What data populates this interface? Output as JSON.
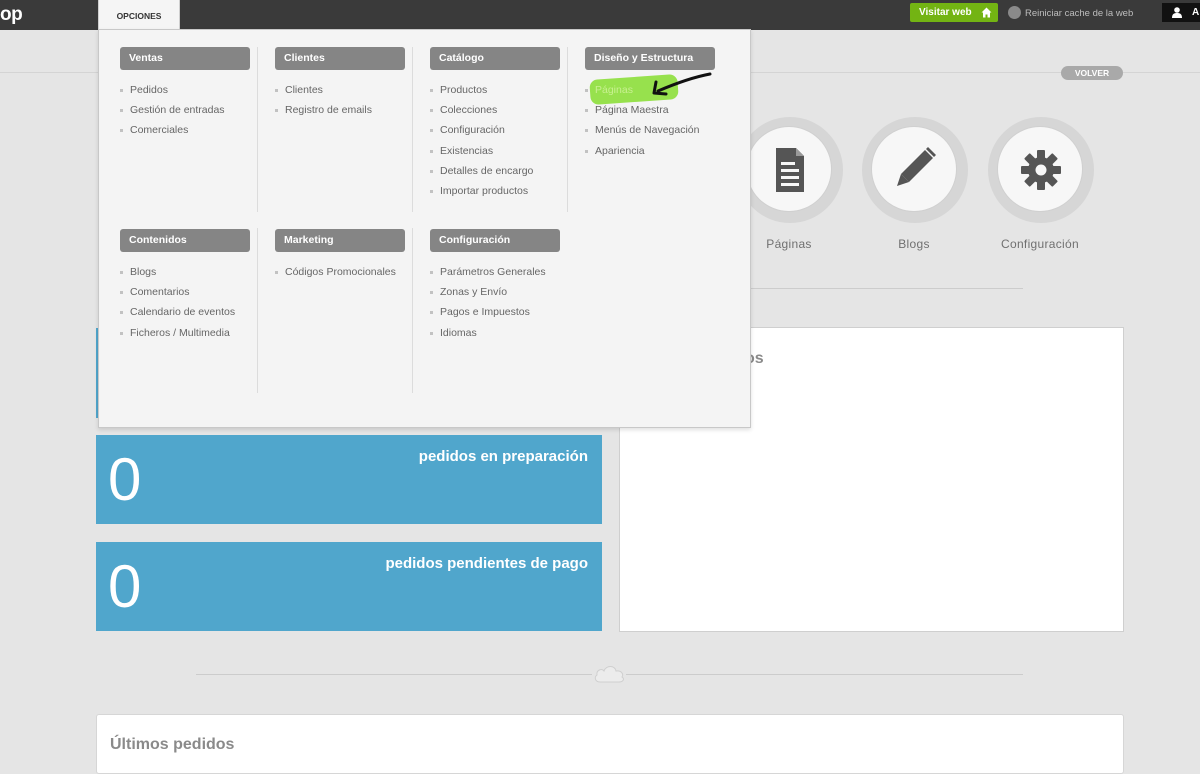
{
  "topbar": {
    "logo": "op",
    "menu_tab": "OPCIONES",
    "visit_web": "Visitar web",
    "reset_cache": "Reiniciar cache de la web",
    "user_initial": "A"
  },
  "header": {
    "back_button": "VOLVER"
  },
  "menu": {
    "sections": [
      {
        "title": "Ventas",
        "items": [
          "Pedidos",
          "Gestión de entradas",
          "Comerciales"
        ]
      },
      {
        "title": "Clientes",
        "items": [
          "Clientes",
          "Registro de emails"
        ]
      },
      {
        "title": "Catálogo",
        "items": [
          "Productos",
          "Colecciones",
          "Configuración",
          "Existencias",
          "Detalles de encargo",
          "Importar productos"
        ]
      },
      {
        "title": "Diseño y Estructura",
        "items": [
          "Páginas",
          "Página Maestra",
          "Menús de Navegación",
          "Apariencia"
        ]
      },
      {
        "title": "Contenidos",
        "items": [
          "Blogs",
          "Comentarios",
          "Calendario de eventos",
          "Ficheros / Multimedia"
        ]
      },
      {
        "title": "Marketing",
        "items": [
          "Códigos Promocionales"
        ]
      },
      {
        "title": "Configuración",
        "items": [
          "Parámetros Generales",
          "Zonas y Envío",
          "Pagos e Impuestos",
          "Idiomas"
        ]
      }
    ],
    "highlight_color": "#8ede3e"
  },
  "shortcuts": [
    {
      "label": "Páginas",
      "icon": "document-icon"
    },
    {
      "label": "Blogs",
      "icon": "pencil-icon"
    },
    {
      "label": "Configuración",
      "icon": "gear-icon"
    }
  ],
  "stats": [
    {
      "value": "0",
      "label": "pedidos en preparación"
    },
    {
      "value": "0",
      "label": "pedidos pendientes de pago"
    }
  ],
  "panel": {
    "title_fragment": "os"
  },
  "bottom": {
    "title": "Últimos pedidos"
  },
  "colors": {
    "topbar": "#3a3a3a",
    "visit_button": "#73b413",
    "stat_blue": "#50a6cc",
    "menu_header": "#858585"
  }
}
